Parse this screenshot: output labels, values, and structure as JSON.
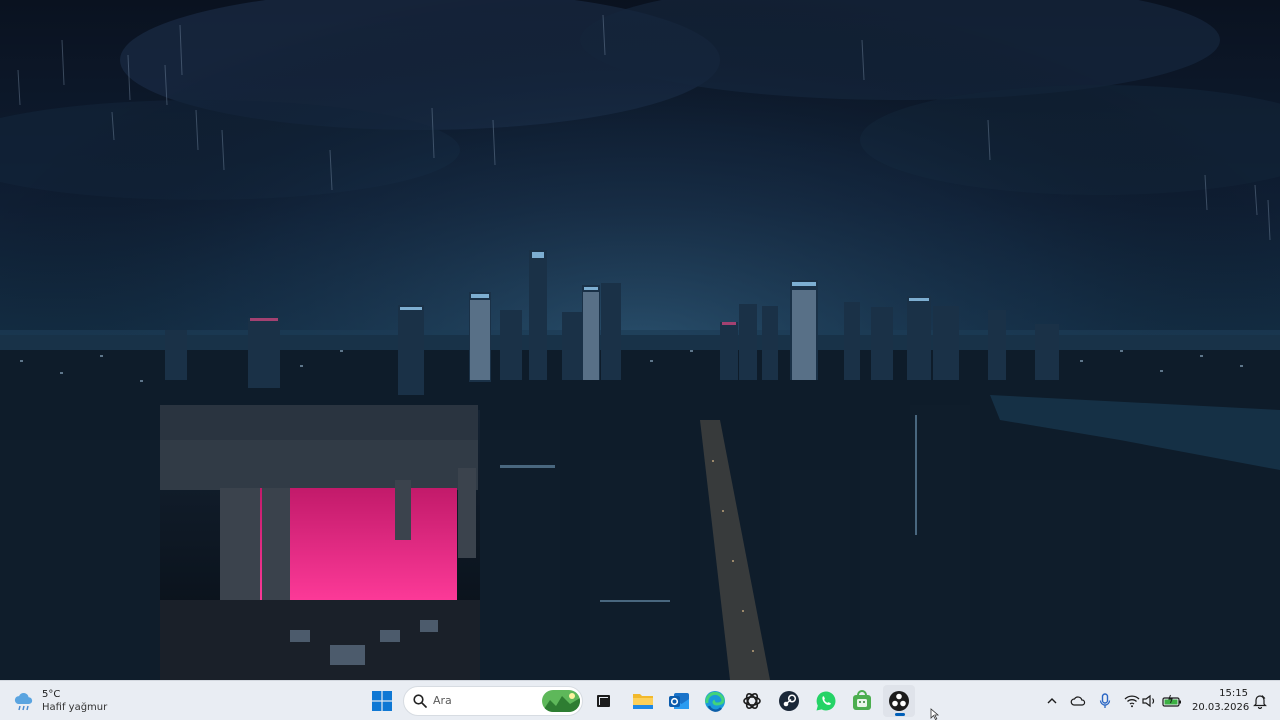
{
  "wallpaper": {
    "sky_top": "#0a1220",
    "horizon": "#143047",
    "accent_pink": "#e0207a",
    "city_light": "#9fd8ff"
  },
  "taskbar": {
    "weather": {
      "temperature": "5°C",
      "condition": "Hafif yağmur",
      "icon": "rain-cloud-icon"
    },
    "start": {
      "icon": "windows-logo-icon"
    },
    "search": {
      "placeholder": "Ara",
      "icon": "search-icon"
    },
    "apps": [
      {
        "name": "task-view",
        "icon": "task-view-icon"
      },
      {
        "name": "file-explorer",
        "icon": "folder-icon"
      },
      {
        "name": "outlook",
        "icon": "outlook-icon"
      },
      {
        "name": "edge",
        "icon": "edge-icon"
      },
      {
        "name": "chatgpt",
        "icon": "chatgpt-icon"
      },
      {
        "name": "steam",
        "icon": "steam-icon"
      },
      {
        "name": "whatsapp",
        "icon": "whatsapp-icon"
      },
      {
        "name": "android-store",
        "icon": "android-store-icon"
      },
      {
        "name": "obs",
        "icon": "obs-icon",
        "active": true
      }
    ],
    "tray": {
      "icons": [
        "chevron-up-icon",
        "onedrive-icon",
        "microphone-icon",
        "wifi-icon",
        "speaker-icon",
        "battery-icon"
      ],
      "time": "15:15",
      "date": "20.03.2026",
      "notification_icon": "notification-bell-icon"
    },
    "accent": "#005fb8"
  }
}
